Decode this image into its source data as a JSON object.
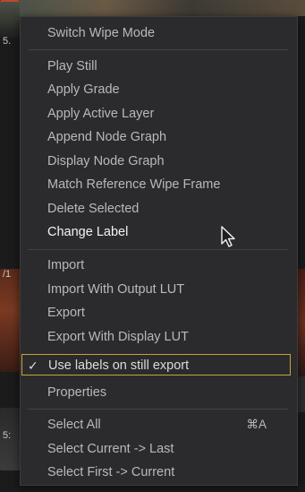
{
  "background": {
    "labels": [
      "5.",
      "/1",
      "5:"
    ]
  },
  "menu": {
    "items": [
      {
        "label": "Switch Wipe Mode"
      },
      {
        "label": "Play Still"
      },
      {
        "label": "Apply Grade"
      },
      {
        "label": "Apply Active Layer"
      },
      {
        "label": "Append Node Graph"
      },
      {
        "label": "Display Node Graph"
      },
      {
        "label": "Match Reference Wipe Frame"
      },
      {
        "label": "Delete Selected"
      },
      {
        "label": "Change Label",
        "hovered": true
      },
      {
        "label": "Import"
      },
      {
        "label": "Import With Output LUT"
      },
      {
        "label": "Export"
      },
      {
        "label": "Export With Display LUT"
      },
      {
        "label": "Use labels on still export",
        "checked": true,
        "check_mark": "✓"
      },
      {
        "label": "Properties"
      },
      {
        "label": "Select All",
        "shortcut": "⌘A"
      },
      {
        "label": "Select Current -> Last"
      },
      {
        "label": "Select First -> Current"
      }
    ]
  },
  "colors": {
    "menu_bg": "#2b2b2d",
    "text": "#b9b9bb",
    "hover_text": "#f4f4f5",
    "checked_outline": "#c9a235"
  },
  "cursor": {
    "icon": "arrow-pointer-icon"
  }
}
